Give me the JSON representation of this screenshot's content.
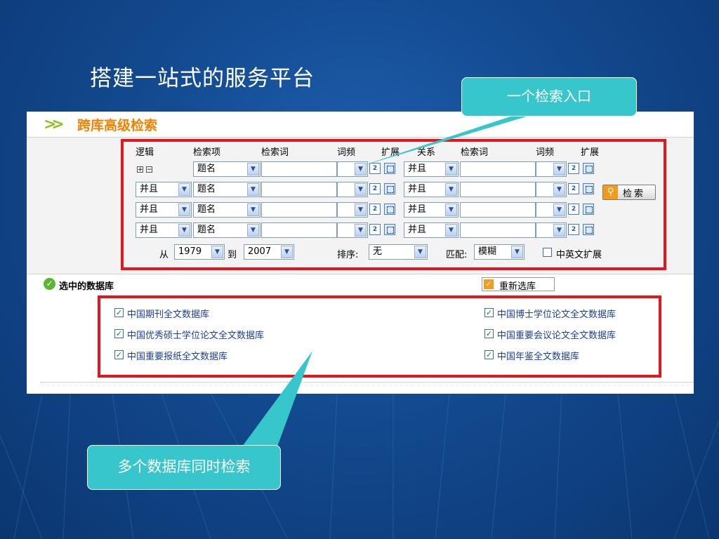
{
  "slide": {
    "title": "搭建一站式的服务平台"
  },
  "panel": {
    "header_title": "跨库高级检索",
    "columns": {
      "logic": "逻辑",
      "field": "检索项",
      "term1": "检索词",
      "freq1": "词频",
      "ext1": "扩展",
      "relation": "关系",
      "term2": "检索词",
      "freq2": "词频",
      "ext2": "扩展"
    },
    "rows": [
      {
        "logic": "",
        "field": "题名",
        "relation": "并且"
      },
      {
        "logic": "并且",
        "field": "题名",
        "relation": "并且"
      },
      {
        "logic": "并且",
        "field": "题名",
        "relation": "并且"
      },
      {
        "logic": "并且",
        "field": "题名",
        "relation": "并且"
      }
    ],
    "freq_icon_text": "2",
    "search_button": "检索",
    "year_from_label": "从",
    "year_from": "1979",
    "year_to_label": "到",
    "year_to": "2007",
    "sort_label": "排序:",
    "sort_value": "无",
    "match_label": "匹配:",
    "match_value": "模糊",
    "expand_label": "中英文扩展",
    "selected_db_title": "选中的数据库",
    "reselect_button": "重新选库",
    "databases": [
      "中国期刊全文数据库",
      "中国博士学位论文全文数据库",
      "中国优秀硕士学位论文全文数据库",
      "中国重要会议论文全文数据库",
      "中国重要报纸全文数据库",
      "中国年鉴全文数据库"
    ]
  },
  "callouts": {
    "entry": "一个检索入口",
    "multi_db": "多个数据库同时检索"
  },
  "colors": {
    "frame_red": "#e4151b",
    "callout_cyan": "#36c6cc",
    "header_orange": "#f08200",
    "bg_blue": "#134a90"
  }
}
